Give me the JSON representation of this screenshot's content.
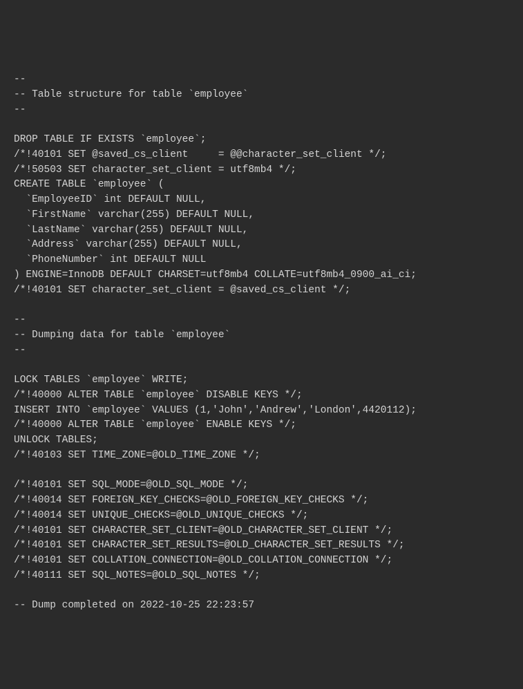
{
  "code": {
    "lines": [
      "--",
      "-- Table structure for table `employee`",
      "--",
      "",
      "DROP TABLE IF EXISTS `employee`;",
      "/*!40101 SET @saved_cs_client     = @@character_set_client */;",
      "/*!50503 SET character_set_client = utf8mb4 */;",
      "CREATE TABLE `employee` (",
      "  `EmployeeID` int DEFAULT NULL,",
      "  `FirstName` varchar(255) DEFAULT NULL,",
      "  `LastName` varchar(255) DEFAULT NULL,",
      "  `Address` varchar(255) DEFAULT NULL,",
      "  `PhoneNumber` int DEFAULT NULL",
      ") ENGINE=InnoDB DEFAULT CHARSET=utf8mb4 COLLATE=utf8mb4_0900_ai_ci;",
      "/*!40101 SET character_set_client = @saved_cs_client */;",
      "",
      "--",
      "-- Dumping data for table `employee`",
      "--",
      "",
      "LOCK TABLES `employee` WRITE;",
      "/*!40000 ALTER TABLE `employee` DISABLE KEYS */;",
      "INSERT INTO `employee` VALUES (1,'John','Andrew','London',4420112);",
      "/*!40000 ALTER TABLE `employee` ENABLE KEYS */;",
      "UNLOCK TABLES;",
      "/*!40103 SET TIME_ZONE=@OLD_TIME_ZONE */;",
      "",
      "/*!40101 SET SQL_MODE=@OLD_SQL_MODE */;",
      "/*!40014 SET FOREIGN_KEY_CHECKS=@OLD_FOREIGN_KEY_CHECKS */;",
      "/*!40014 SET UNIQUE_CHECKS=@OLD_UNIQUE_CHECKS */;",
      "/*!40101 SET CHARACTER_SET_CLIENT=@OLD_CHARACTER_SET_CLIENT */;",
      "/*!40101 SET CHARACTER_SET_RESULTS=@OLD_CHARACTER_SET_RESULTS */;",
      "/*!40101 SET COLLATION_CONNECTION=@OLD_COLLATION_CONNECTION */;",
      "/*!40111 SET SQL_NOTES=@OLD_SQL_NOTES */;",
      "",
      "-- Dump completed on 2022-10-25 22:23:57"
    ]
  }
}
